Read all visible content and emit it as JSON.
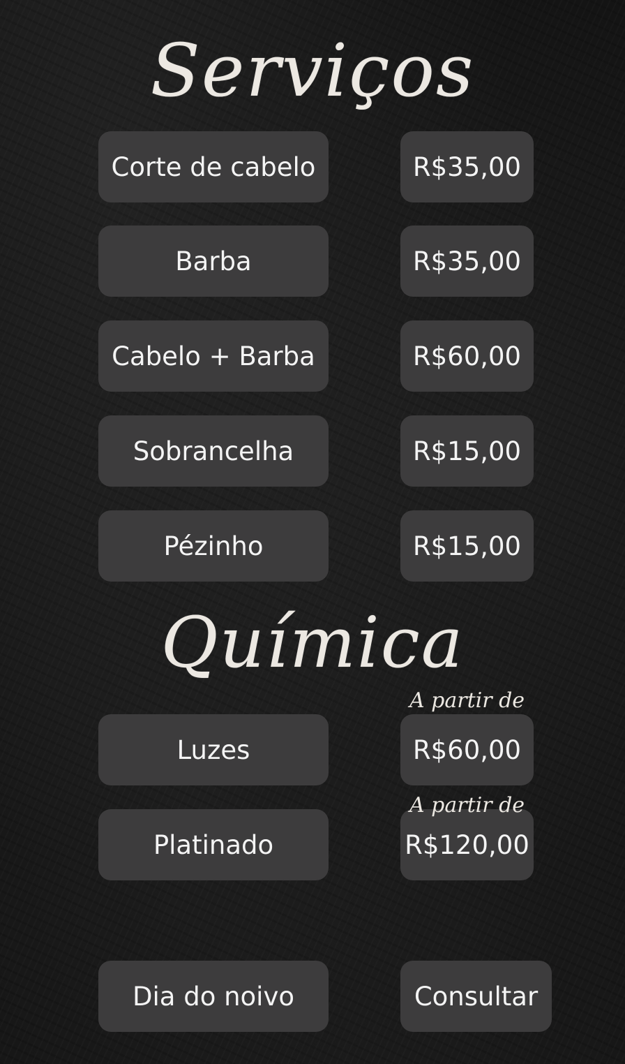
{
  "headings": {
    "services": "Serviços",
    "chemistry": "Química"
  },
  "services": [
    {
      "name": "Corte de cabelo",
      "price": "R$35,00"
    },
    {
      "name": "Barba",
      "price": "R$35,00"
    },
    {
      "name": "Cabelo + Barba",
      "price": "R$60,00"
    },
    {
      "name": "Sobrancelha",
      "price": "R$15,00"
    },
    {
      "name": "Pézinho",
      "price": "R$15,00"
    }
  ],
  "chemistry": [
    {
      "name": "Luzes",
      "price": "R$60,00",
      "note": "A partir de"
    },
    {
      "name": "Platinado",
      "price": "R$120,00",
      "note": "A partir de"
    }
  ],
  "special": {
    "name": "Dia do noivo",
    "price": "Consultar"
  },
  "colors": {
    "background": "#141414",
    "pill": "#3d3c3d",
    "text": "#f4f4f4"
  }
}
